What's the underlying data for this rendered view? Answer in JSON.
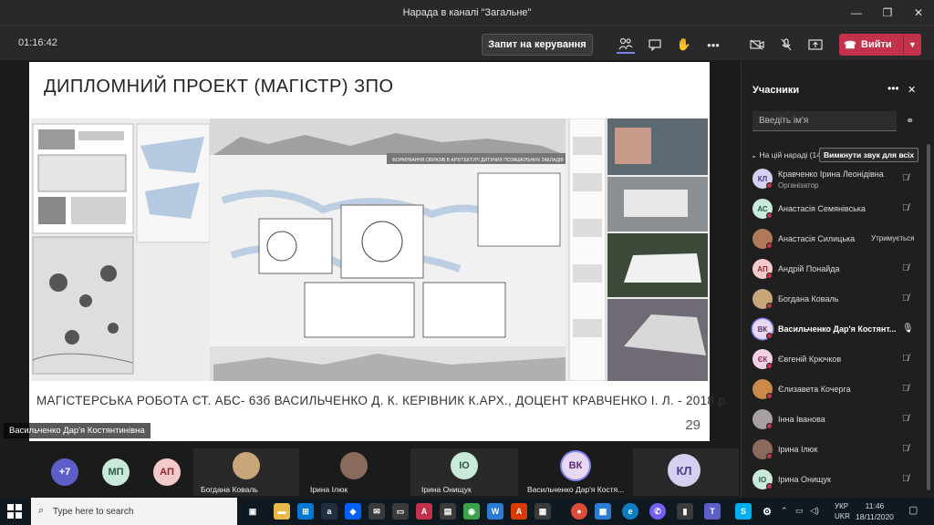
{
  "window": {
    "title": "Нарада в каналі \"Загальне\""
  },
  "toolbar": {
    "timer": "01:16:42",
    "request_control": "Запит на керування",
    "leave": "Вийти"
  },
  "slide": {
    "title": "ДИПЛОМНИЙ ПРОЕКТ (МАГІСТР) ЗПО",
    "poster_banner": "ФОРМУВАННЯ ОБРАЗІВ В АРХІТЕКТУРІ ДИТЯЧИХ ПОЗАШКІЛЬНИХ ЗАКЛАДІВ",
    "caption": "МАГІСТЕРСЬКА РОБОТА СТ. АБС- 63б ВАСИЛЬЧЕНКО Д. К. КЕРІВНИК К.АРХ., ДОЦЕНТ КРАВЧЕНКО І. Л.  - 2018 р.",
    "page_number": "29"
  },
  "presenter": {
    "label": "Васильченко Дар'я Костянтинівна"
  },
  "gallery": {
    "overflow": "+7",
    "tiles": [
      {
        "initials": "МП"
      },
      {
        "initials": "АП"
      },
      {
        "name": "Богдана Коваль"
      },
      {
        "name": "Ірина Ілюк"
      },
      {
        "initials": "ІО",
        "name": "Ірина Онищук"
      },
      {
        "initials": "ВК",
        "name": "Васильченко Дар'я Костя..."
      },
      {
        "initials": "КЛ"
      }
    ]
  },
  "participants": {
    "title": "Учасники",
    "search_placeholder": "Введіть ім'я",
    "section_label": "На цій нараді (14)",
    "mute_all": "Вимкнути звук для всіх",
    "list": [
      {
        "initials": "КЛ",
        "name": "Кравченко Ірина Леонідівна",
        "role": "Організатор",
        "color": "#d6d0f0"
      },
      {
        "initials": "АС",
        "name": "Анастасія Семянівська",
        "color": "#c9e9d9"
      },
      {
        "initials": "",
        "name": "Анастасія Силицька",
        "status": "Утримується",
        "color": "#b07a5a"
      },
      {
        "initials": "АП",
        "name": "Андрій Понайда",
        "color": "#f3c9c9"
      },
      {
        "initials": "",
        "name": "Богдана Коваль",
        "color": "#c9a57a"
      },
      {
        "initials": "ВК",
        "name": "Васильченко Дар'я Костянт...",
        "color": "#ead8f3"
      },
      {
        "initials": "ЄК",
        "name": "Євгеній Крючков",
        "color": "#f3d0e4"
      },
      {
        "initials": "",
        "name": "Єлизавета Кочерга",
        "color": "#c98a4a"
      },
      {
        "initials": "",
        "name": "Інна Іванова",
        "color": "#a8a0a0"
      },
      {
        "initials": "",
        "name": "Ірина Ілюк",
        "color": "#8a6a5a"
      },
      {
        "initials": "ІО",
        "name": "Ірина Онищук",
        "color": "#c9e9d9"
      }
    ]
  },
  "taskbar": {
    "search_placeholder": "Type here to search",
    "lang_top": "УКР",
    "lang_bottom": "UKR",
    "time": "11:46",
    "date": "18/11/2020"
  }
}
